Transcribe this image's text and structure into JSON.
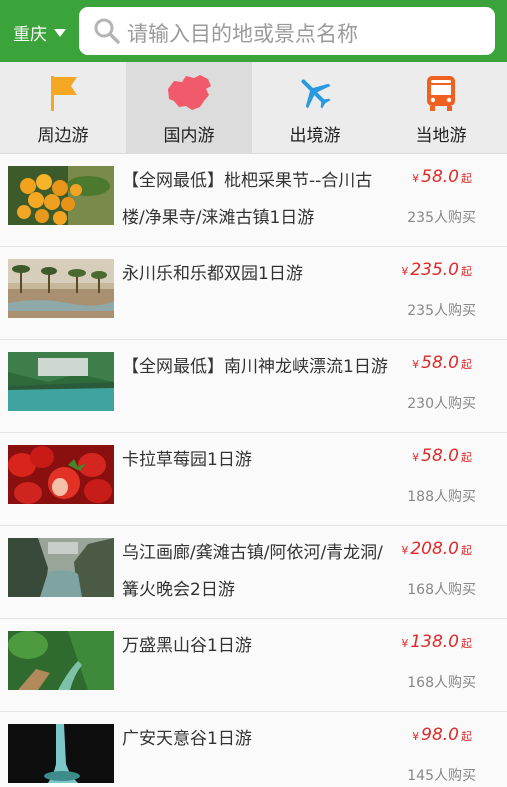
{
  "header": {
    "city": "重庆",
    "search_placeholder": "请输入目的地或景点名称"
  },
  "tabs": [
    {
      "label": "周边游",
      "icon": "flag-icon",
      "color": "#f5a623"
    },
    {
      "label": "国内游",
      "icon": "china-map-icon",
      "color": "#f05a6a"
    },
    {
      "label": "出境游",
      "icon": "airplane-icon",
      "color": "#2a9ae0"
    },
    {
      "label": "当地游",
      "icon": "bus-icon",
      "color": "#f06020"
    }
  ],
  "items": [
    {
      "title": "【全网最低】枇杷采果节--合川古楼/净果寺/涞滩古镇1日游",
      "currency": "¥",
      "price": "58.0",
      "suffix": "起",
      "buyers": "235人购买"
    },
    {
      "title": "永川乐和乐都双园1日游",
      "currency": "¥",
      "price": "235.0",
      "suffix": "起",
      "buyers": "235人购买"
    },
    {
      "title": "【全网最低】南川神龙峡漂流1日游",
      "currency": "¥",
      "price": "58.0",
      "suffix": "起",
      "buyers": "230人购买"
    },
    {
      "title": "卡拉草莓园1日游",
      "currency": "¥",
      "price": "58.0",
      "suffix": "起",
      "buyers": "188人购买"
    },
    {
      "title": "乌江画廊/龚滩古镇/阿依河/青龙洞/篝火晚会2日游",
      "currency": "¥",
      "price": "208.0",
      "suffix": "起",
      "buyers": "168人购买"
    },
    {
      "title": "万盛黑山谷1日游",
      "currency": "¥",
      "price": "138.0",
      "suffix": "起",
      "buyers": "168人购买"
    },
    {
      "title": "广安天意谷1日游",
      "currency": "¥",
      "price": "98.0",
      "suffix": "起",
      "buyers": "145人购买"
    }
  ],
  "colors": {
    "header": "#3aa33a",
    "price": "#e02a2a"
  }
}
